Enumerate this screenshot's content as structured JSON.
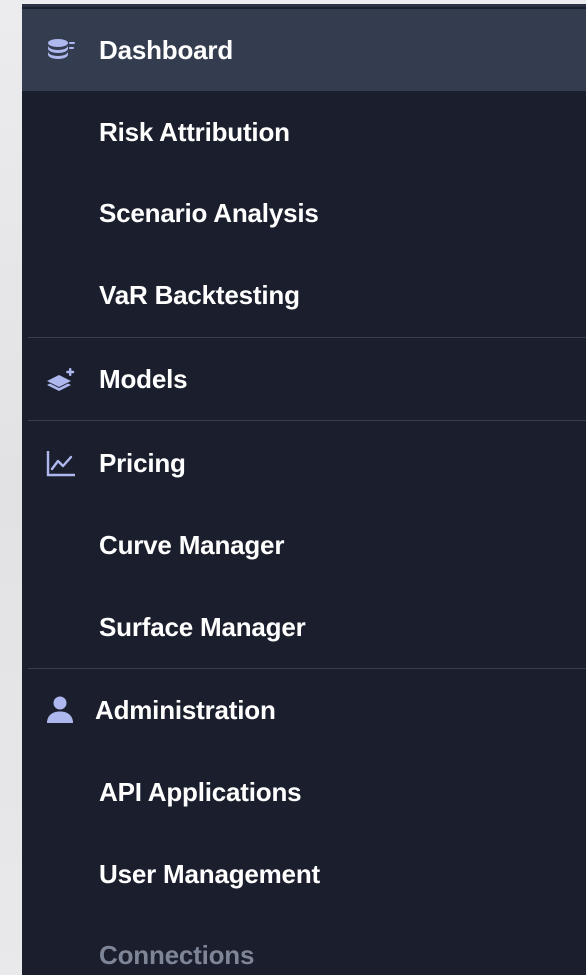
{
  "colors": {
    "sidebar_bg": "#1b1f2d",
    "active_bg": "#343d4f",
    "icon_color": "#aeb8ef",
    "text": "#ffffff",
    "muted_text": "#7d8597"
  },
  "nav": {
    "dashboard": {
      "label": "Dashboard",
      "icon": "database-stack-icon",
      "active": true
    },
    "risk_attribution": {
      "label": "Risk Attribution"
    },
    "scenario_analysis": {
      "label": "Scenario Analysis"
    },
    "var_backtesting": {
      "label": "VaR Backtesting"
    },
    "models": {
      "label": "Models",
      "icon": "layers-plus-icon"
    },
    "pricing": {
      "label": "Pricing",
      "icon": "line-chart-icon"
    },
    "curve_manager": {
      "label": "Curve Manager"
    },
    "surface_manager": {
      "label": "Surface Manager"
    },
    "administration": {
      "label": "Administration",
      "icon": "user-icon"
    },
    "api_applications": {
      "label": "API Applications"
    },
    "user_management": {
      "label": "User Management"
    },
    "connections": {
      "label": "Connections"
    }
  }
}
